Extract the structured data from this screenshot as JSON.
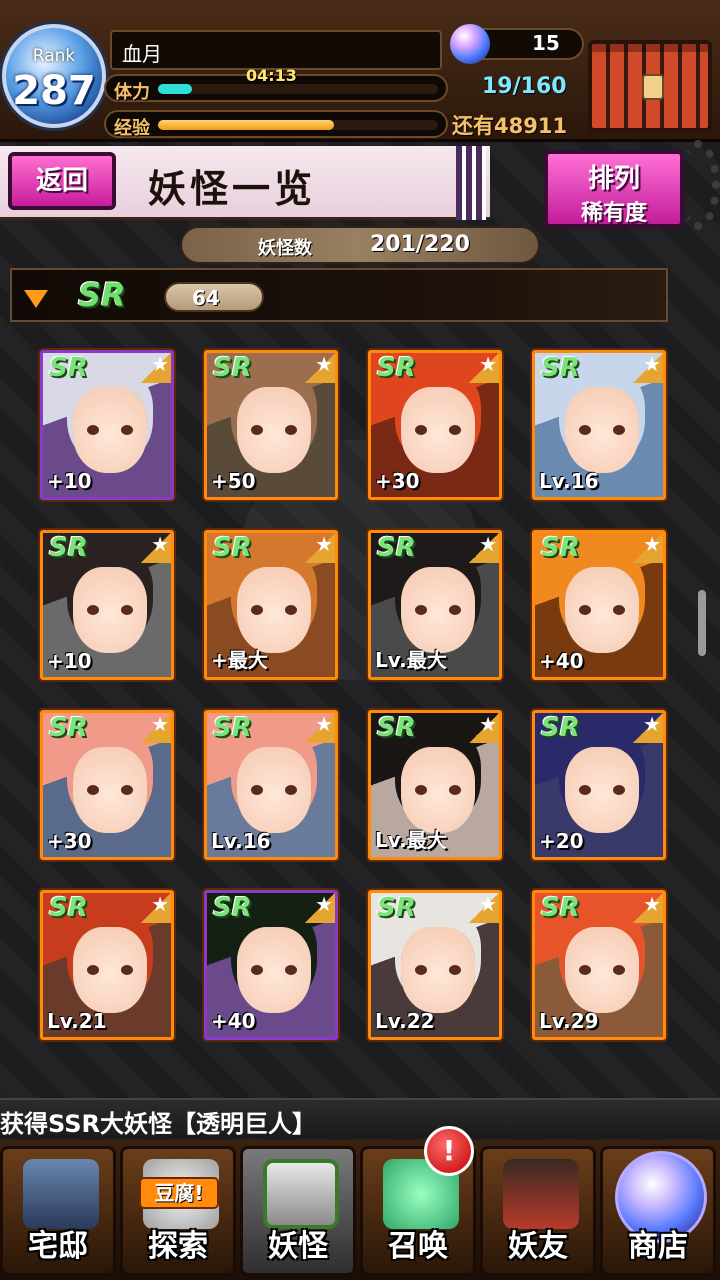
{
  "header": {
    "rank_label": "Rank",
    "rank_value": "287",
    "player_name": "血月",
    "stamina_label": "体力",
    "stamina_timer": "04:13",
    "stamina_count": "19/160",
    "stamina_fraction": 0.12,
    "exp_label": "经验",
    "exp_fraction": 0.63,
    "gem_count": "15",
    "money_label": "还有48911"
  },
  "title_bar": {
    "back_label": "返回",
    "page_title": "妖怪一览",
    "sort_label": "排列",
    "sort_value": "稀有度"
  },
  "count_bar": {
    "label": "妖怪数",
    "value": "201/220"
  },
  "section": {
    "rarity": "SR",
    "count": "64"
  },
  "cards": [
    {
      "rarity": "SR",
      "level": "+10",
      "hair": "#d9d9e6",
      "bg": "#6a4a8a"
    },
    {
      "rarity": "SR",
      "level": "+50",
      "hair": "#9a6e4e",
      "bg": "#5a4a3a"
    },
    {
      "rarity": "SR",
      "level": "+30",
      "hair": "#e0461e",
      "bg": "#7a2a14"
    },
    {
      "rarity": "SR",
      "level": "Lv.16",
      "hair": "#c8d6ec",
      "bg": "#6a8ab0"
    },
    {
      "rarity": "SR",
      "level": "+10",
      "hair": "#2a2220",
      "bg": "#6a6a6a"
    },
    {
      "rarity": "SR",
      "level": "+最大",
      "hair": "#d4782e",
      "bg": "#8a4a22"
    },
    {
      "rarity": "SR",
      "level": "Lv.最大",
      "hair": "#1e1a1a",
      "bg": "#4a4a4a"
    },
    {
      "rarity": "SR",
      "level": "+40",
      "hair": "#f08a1e",
      "bg": "#7a3a10"
    },
    {
      "rarity": "SR",
      "level": "+30",
      "hair": "#f29a8a",
      "bg": "#5a6a8a"
    },
    {
      "rarity": "SR",
      "level": "Lv.16",
      "hair": "#f29a8a",
      "bg": "#6a7a9a"
    },
    {
      "rarity": "SR",
      "level": "Lv.最大",
      "hair": "#1a1614",
      "bg": "#b8a8a0"
    },
    {
      "rarity": "SR",
      "level": "+20",
      "hair": "#2a2a6a",
      "bg": "#3a3a6a"
    },
    {
      "rarity": "SR",
      "level": "Lv.21",
      "hair": "#c83c1e",
      "bg": "#6a3a2a"
    },
    {
      "rarity": "SR",
      "level": "+40",
      "hair": "#142014",
      "bg": "#6a4a8a"
    },
    {
      "rarity": "SR",
      "level": "Lv.22",
      "hair": "#e8e4e0",
      "bg": "#4a3a3a"
    },
    {
      "rarity": "SR",
      "level": "Lv.29",
      "hair": "#e8542a",
      "bg": "#8a5a3a"
    }
  ],
  "ticker": {
    "text": "获得SSR大妖怪【透明巨人】"
  },
  "nav": {
    "items": [
      {
        "label": "宅邸"
      },
      {
        "label": "探索",
        "tag": "豆腐!"
      },
      {
        "label": "妖怪"
      },
      {
        "label": "召唤",
        "alert": "!"
      },
      {
        "label": "妖友"
      },
      {
        "label": "商店"
      }
    ]
  },
  "colors": {
    "card_border": "#ff8a0e",
    "sr_green": "#7be37a",
    "accent_pink": "#e236b4"
  }
}
